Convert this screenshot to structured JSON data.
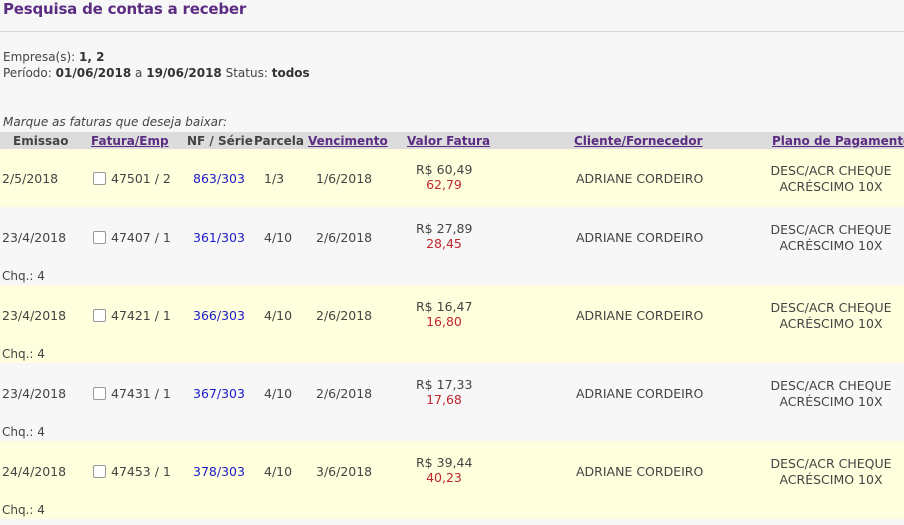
{
  "page": {
    "title": "Pesquisa de contas a receber",
    "empresas_label": "Empresa(s):",
    "empresas_value": "1, 2",
    "periodo_label": "Período:",
    "periodo_start": "01/06/2018",
    "periodo_sep": "a",
    "periodo_end": "19/06/2018",
    "status_label": "Status:",
    "status_value": "todos",
    "instruction": "Marque as faturas que deseja baixar:"
  },
  "table": {
    "headers": {
      "emissao": "Emissao",
      "fatura": "Fatura/Emp",
      "nf": "NF / Série",
      "parcela": "Parcela",
      "vencimento": "Vencimento",
      "valor": "Valor Fatura",
      "cliente": "Cliente/Fornecedor",
      "plano": "Plano de Pagamento"
    },
    "rows": [
      {
        "emissao": "2/5/2018",
        "fatura": "47501 / 2",
        "nf": "863/303",
        "parcela": "1/3",
        "vencimento": "1/6/2018",
        "valor": "R$ 60,49",
        "valor2": "62,79",
        "cliente": "ADRIANE CORDEIRO",
        "plano1": "DESC/ACR CHEQUE",
        "plano2": "ACRÉSCIMO 10X",
        "chq": ""
      },
      {
        "emissao": "23/4/2018",
        "fatura": "47407 / 1",
        "nf": "361/303",
        "parcela": "4/10",
        "vencimento": "2/6/2018",
        "valor": "R$ 27,89",
        "valor2": "28,45",
        "cliente": "ADRIANE CORDEIRO",
        "plano1": "DESC/ACR CHEQUE",
        "plano2": "ACRÉSCIMO 10X",
        "chq": "Chq.: 4"
      },
      {
        "emissao": "23/4/2018",
        "fatura": "47421 / 1",
        "nf": "366/303",
        "parcela": "4/10",
        "vencimento": "2/6/2018",
        "valor": "R$ 16,47",
        "valor2": "16,80",
        "cliente": "ADRIANE CORDEIRO",
        "plano1": "DESC/ACR CHEQUE",
        "plano2": "ACRÉSCIMO 10X",
        "chq": "Chq.: 4"
      },
      {
        "emissao": "23/4/2018",
        "fatura": "47431 / 1",
        "nf": "367/303",
        "parcela": "4/10",
        "vencimento": "2/6/2018",
        "valor": "R$ 17,33",
        "valor2": "17,68",
        "cliente": "ADRIANE CORDEIRO",
        "plano1": "DESC/ACR CHEQUE",
        "plano2": "ACRÉSCIMO 10X",
        "chq": "Chq.: 4"
      },
      {
        "emissao": "24/4/2018",
        "fatura": "47453 / 1",
        "nf": "378/303",
        "parcela": "4/10",
        "vencimento": "3/6/2018",
        "valor": "R$ 39,44",
        "valor2": "40,23",
        "cliente": "ADRIANE CORDEIRO",
        "plano1": "DESC/ACR CHEQUE",
        "plano2": "ACRÉSCIMO 10X",
        "chq": "Chq.: 4"
      }
    ]
  }
}
